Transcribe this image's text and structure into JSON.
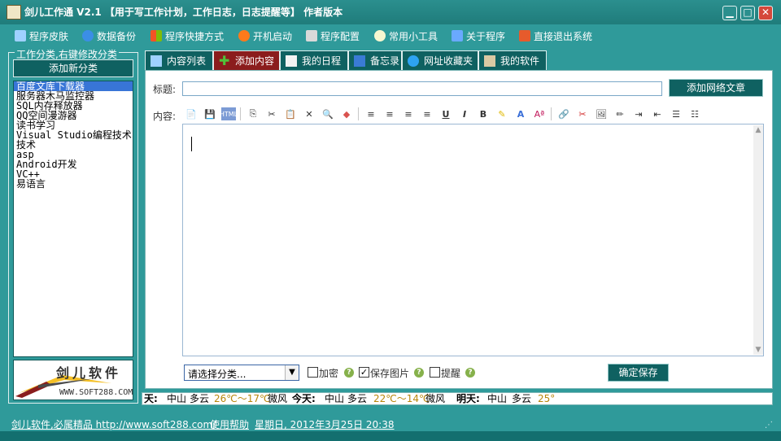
{
  "titlebar": {
    "title": "剑儿工作通 V2.1 【用于写工作计划，工作日志，日志提醒等】 作者版本"
  },
  "menu": [
    {
      "label": "程序皮肤",
      "icon": "shirt-icon",
      "color": "#9fd1ff"
    },
    {
      "label": "数据备份",
      "icon": "globe-backup-icon",
      "color": "#3b8ee6"
    },
    {
      "label": "程序快捷方式",
      "icon": "windows-logo-icon",
      "color": "#f35325"
    },
    {
      "label": "开机启动",
      "icon": "lifebuoy-icon",
      "color": "#ff7a1a"
    },
    {
      "label": "程序配置",
      "icon": "tools-icon",
      "color": "#d9d9d9"
    },
    {
      "label": "常用小工具",
      "icon": "lightbulb-icon",
      "color": "#f7f7d0"
    },
    {
      "label": "关于程序",
      "icon": "monitor-icon",
      "color": "#6aa9ff"
    },
    {
      "label": "直接退出系统",
      "icon": "gift-exit-icon",
      "color": "#e65b2c"
    }
  ],
  "sidebar": {
    "legend": "工作分类,右键修改分类",
    "add_button": "添加新分类",
    "categories": [
      "百度文库下载器",
      "服务器木马监控器",
      "SQL内存释放器",
      "QQ空间漫游器",
      "读书学习",
      "Visual Studio编程技术",
      "技术",
      "asp",
      "Android开发",
      "VC++",
      "易语言"
    ],
    "selected_index": 0,
    "logo": {
      "title": "剑儿软件",
      "url": "WWW.SOFT288.COM"
    }
  },
  "tabs": [
    {
      "label": "内容列表",
      "icon": "list-icon",
      "active": false
    },
    {
      "label": "添加内容",
      "icon": "plus-icon",
      "active": true
    },
    {
      "label": "我的日程",
      "icon": "calendar-icon",
      "active": false
    },
    {
      "label": "备忘录",
      "icon": "notebook-icon",
      "active": false
    },
    {
      "label": "网址收藏夹",
      "icon": "globe-icon",
      "active": false
    },
    {
      "label": "我的软件",
      "icon": "pencil-icon",
      "active": false
    }
  ],
  "form": {
    "title_label": "标题:",
    "title_value": "",
    "add_article_button": "添加网络文章",
    "content_label": "内容:",
    "category_select": "请选择分类...",
    "checkboxes": [
      {
        "label": "加密",
        "checked": false
      },
      {
        "label": "保存图片",
        "checked": true
      },
      {
        "label": "提醒",
        "checked": false
      }
    ],
    "save_button": "确定保存"
  },
  "toolbar_icons": [
    "new-doc-icon",
    "save-icon",
    "html-icon",
    "copy-icon",
    "cut-icon",
    "paste-icon",
    "delete-icon",
    "find-icon",
    "eraser-icon",
    "align-left-icon",
    "align-center-icon",
    "align-justify-icon",
    "align-right-icon",
    "underline-icon",
    "italic-icon",
    "bold-icon",
    "highlight-icon",
    "font-color-icon",
    "font-size-icon",
    "link-icon",
    "unlink-icon",
    "image-icon",
    "edit-icon",
    "indent-icon",
    "outdent-icon",
    "bullets-icon",
    "numbering-icon"
  ],
  "weather": {
    "today": {
      "label": "天:",
      "city": "中山",
      "desc": "多云",
      "temp": "26℃～17℃",
      "wind": "微风"
    },
    "tomorrow": {
      "label": "今天:",
      "city": "中山",
      "desc": "多云",
      "temp": "22℃～14℃",
      "wind": "微风"
    },
    "next": {
      "label": "明天:",
      "city": "中山",
      "desc": "多云",
      "temp": "25°"
    }
  },
  "status": {
    "link1": "剑儿软件,必属精品 http://www.soft288.com/",
    "link2": "使用帮助",
    "datetime": "星期日, 2012年3月25日 20:38"
  }
}
